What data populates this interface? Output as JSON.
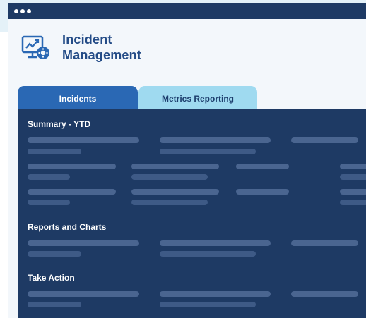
{
  "app": {
    "title_line1": "Incident",
    "title_line2": "Management",
    "icon": "monitor-chart-gear-icon"
  },
  "tabs": [
    {
      "label": "Incidents",
      "active": true
    },
    {
      "label": "Metrics Reporting",
      "active": false
    }
  ],
  "sections": [
    {
      "title": "Summary - YTD"
    },
    {
      "title": "Reports and Charts"
    },
    {
      "title": "Take Action"
    }
  ],
  "colors": {
    "titlebar": "#1e3a64",
    "panel": "#1e3a64",
    "active_tab": "#2a68b4",
    "inactive_tab": "#9fdaf0",
    "title_text": "#244c87",
    "placeholder_bar": "#4a6590"
  }
}
